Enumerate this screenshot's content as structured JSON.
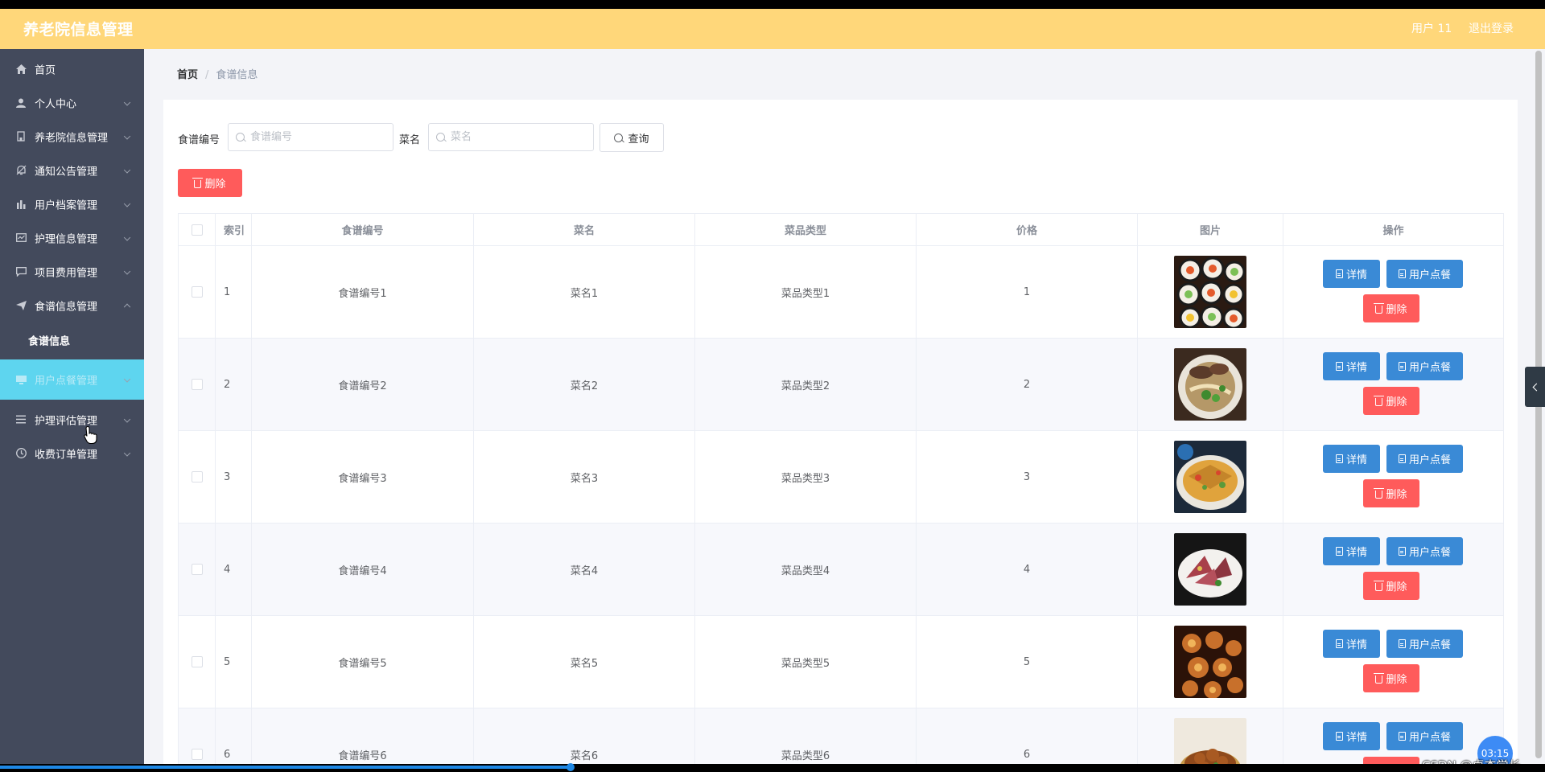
{
  "header": {
    "title": "养老院信息管理",
    "user": "用户 11",
    "logout": "退出登录"
  },
  "sidebar": {
    "items": [
      {
        "label": "首页",
        "icon": "home-icon"
      },
      {
        "label": "个人中心",
        "icon": "user-icon"
      },
      {
        "label": "养老院信息管理",
        "icon": "building-icon"
      },
      {
        "label": "通知公告管理",
        "icon": "bell-icon"
      },
      {
        "label": "用户档案管理",
        "icon": "chart-icon"
      },
      {
        "label": "护理信息管理",
        "icon": "monitor-icon"
      },
      {
        "label": "项目费用管理",
        "icon": "message-icon"
      },
      {
        "label": "食谱信息管理",
        "icon": "send-icon"
      },
      {
        "label": "用户点餐管理",
        "icon": "screen-icon"
      },
      {
        "label": "护理评估管理",
        "icon": "list-icon"
      },
      {
        "label": "收费订单管理",
        "icon": "clock-icon"
      }
    ],
    "sub_item": "食谱信息"
  },
  "breadcrumb": {
    "home": "首页",
    "separator": "/",
    "current": "食谱信息"
  },
  "search": {
    "recipe_no_label": "食谱编号",
    "recipe_no_placeholder": "食谱编号",
    "dish_label": "菜名",
    "dish_placeholder": "菜名",
    "query_button": "查询"
  },
  "toolbar": {
    "delete_button": "删除"
  },
  "table": {
    "headers": [
      "索引",
      "食谱编号",
      "菜名",
      "菜品类型",
      "价格",
      "图片",
      "操作"
    ],
    "rows": [
      {
        "index": "1",
        "recipe_no": "食谱编号1",
        "dish": "菜名1",
        "type": "菜品类型1",
        "price": "1"
      },
      {
        "index": "2",
        "recipe_no": "食谱编号2",
        "dish": "菜名2",
        "type": "菜品类型2",
        "price": "2"
      },
      {
        "index": "3",
        "recipe_no": "食谱编号3",
        "dish": "菜名3",
        "type": "菜品类型3",
        "price": "3"
      },
      {
        "index": "4",
        "recipe_no": "食谱编号4",
        "dish": "菜名4",
        "type": "菜品类型4",
        "price": "4"
      },
      {
        "index": "5",
        "recipe_no": "食谱编号5",
        "dish": "菜名5",
        "type": "菜品类型5",
        "price": "5"
      },
      {
        "index": "6",
        "recipe_no": "食谱编号6",
        "dish": "菜名6",
        "type": "菜品类型6",
        "price": "6"
      }
    ],
    "actions": {
      "detail": "详情",
      "order": "用户点餐",
      "delete": "删除"
    }
  },
  "overlay": {
    "timer": "03:15",
    "watermark": "CSDN @卓杰学长"
  },
  "colors": {
    "header_bg": "#ffd77a",
    "sidebar_bg": "#434a5c",
    "sidebar_active": "#5ed5ef",
    "button_blue": "#3a8ad6",
    "button_red": "#ff5b5b"
  }
}
